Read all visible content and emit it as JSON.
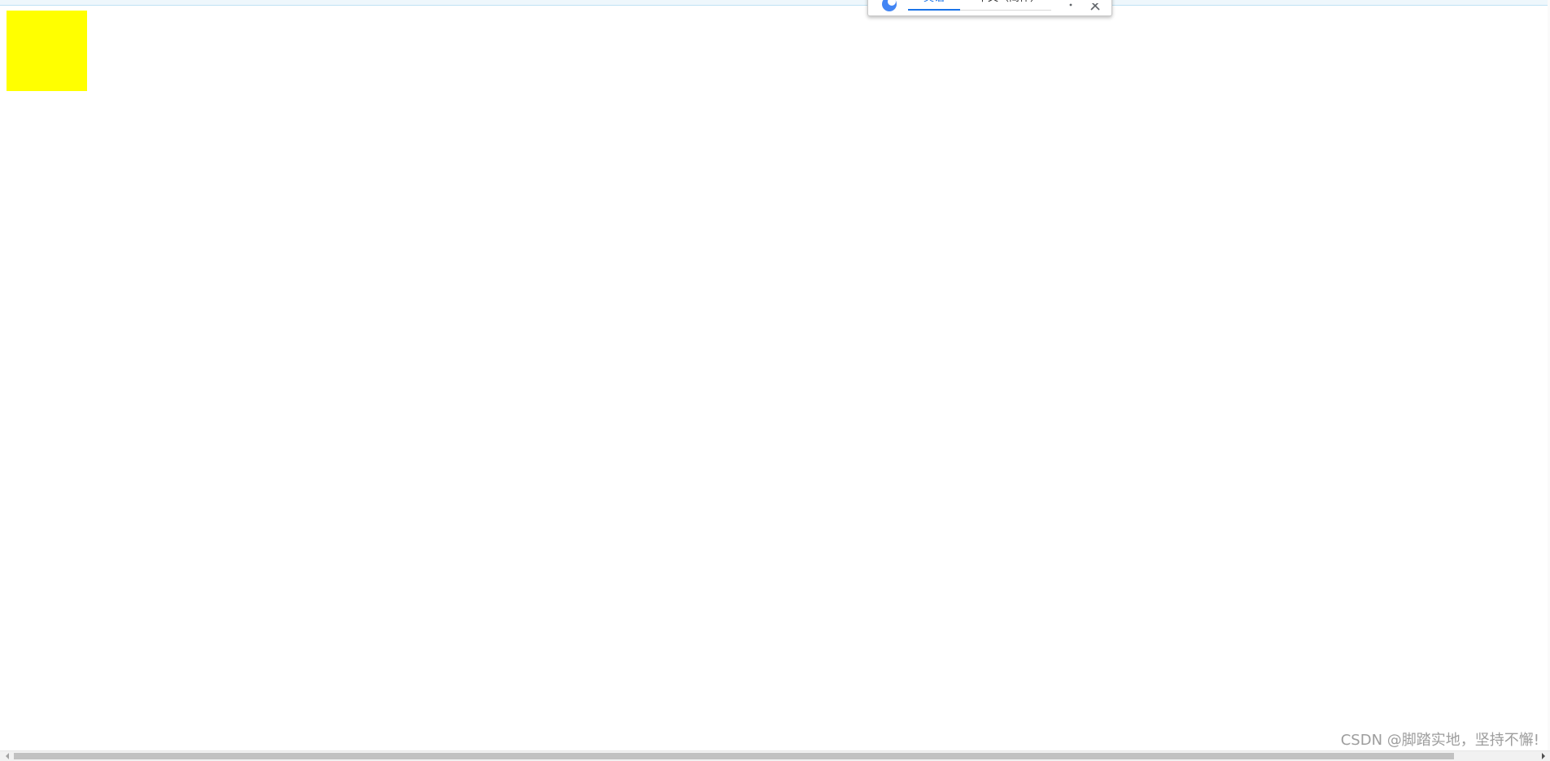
{
  "colors": {
    "box_fill": "#ffff00",
    "accent": "#1a73e8",
    "top_band": "#eef7fc"
  },
  "translate_popup": {
    "tab_english": "英语",
    "tab_chinese": "中文（简体）",
    "logo_icon": "google-translate-icon",
    "menu_icon": "more-vert-icon",
    "close_icon": "close-icon"
  },
  "watermark": {
    "text": "CSDN @脚踏实地，坚持不懈!"
  },
  "scrollbar": {
    "left_icon": "arrow-left-icon",
    "right_icon": "arrow-right-icon"
  }
}
